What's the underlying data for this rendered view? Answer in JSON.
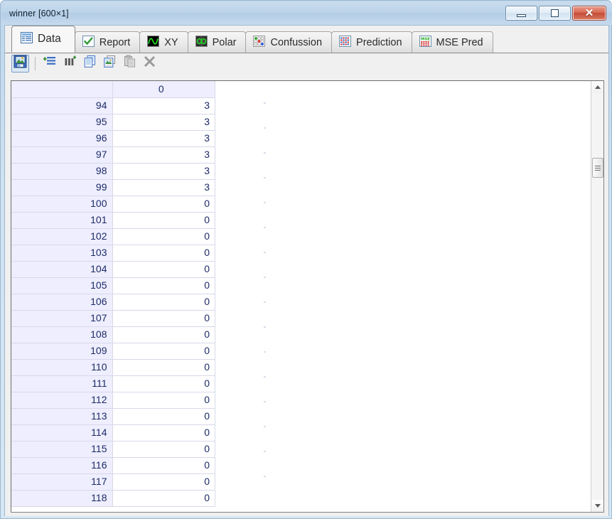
{
  "window": {
    "title": "winner [600×1]",
    "controls": {
      "minimize_label": "Minimize",
      "maximize_label": "Maximize",
      "close_label": "✕"
    }
  },
  "tabs": [
    {
      "id": "data",
      "label": "Data",
      "icon": "spreadsheet-grid-icon",
      "active": true
    },
    {
      "id": "report",
      "label": "Report",
      "icon": "green-check-icon",
      "active": false
    },
    {
      "id": "xy",
      "label": "XY",
      "icon": "sine-wave-icon",
      "active": false
    },
    {
      "id": "polar",
      "label": "Polar",
      "icon": "polar-figure-eight-icon",
      "active": false
    },
    {
      "id": "confussion",
      "label": "Confussion",
      "icon": "confusion-dots-icon",
      "active": false
    },
    {
      "id": "prediction",
      "label": "Prediction",
      "icon": "prediction-grid-icon",
      "active": false
    },
    {
      "id": "msepred",
      "label": "MSE Pred",
      "icon": "mse-grid-icon",
      "active": false
    }
  ],
  "toolbar": [
    {
      "id": "save-image",
      "icon": "save-picture-icon",
      "enabled": true,
      "title": "Save image"
    },
    {
      "id": "separator",
      "icon": "separator",
      "enabled": false,
      "title": ""
    },
    {
      "id": "insert-rows",
      "icon": "insert-rows-icon",
      "enabled": true,
      "title": "Insert rows"
    },
    {
      "id": "insert-columns",
      "icon": "insert-columns-icon",
      "enabled": true,
      "title": "Insert columns"
    },
    {
      "id": "copy",
      "icon": "copy-pages-icon",
      "enabled": true,
      "title": "Copy"
    },
    {
      "id": "copy-image",
      "icon": "copy-image-icon",
      "enabled": true,
      "title": "Copy image"
    },
    {
      "id": "paste",
      "icon": "paste-clipboard-icon",
      "enabled": false,
      "title": "Paste"
    },
    {
      "id": "delete",
      "icon": "delete-x-icon",
      "enabled": false,
      "title": "Delete"
    }
  ],
  "grid": {
    "corner_label": "",
    "columns": [
      "0"
    ],
    "rows": [
      {
        "index": "94",
        "values": [
          "3"
        ]
      },
      {
        "index": "95",
        "values": [
          "3"
        ]
      },
      {
        "index": "96",
        "values": [
          "3"
        ]
      },
      {
        "index": "97",
        "values": [
          "3"
        ]
      },
      {
        "index": "98",
        "values": [
          "3"
        ]
      },
      {
        "index": "99",
        "values": [
          "3"
        ]
      },
      {
        "index": "100",
        "values": [
          "0"
        ]
      },
      {
        "index": "101",
        "values": [
          "0"
        ]
      },
      {
        "index": "102",
        "values": [
          "0"
        ]
      },
      {
        "index": "103",
        "values": [
          "0"
        ]
      },
      {
        "index": "104",
        "values": [
          "0"
        ]
      },
      {
        "index": "105",
        "values": [
          "0"
        ]
      },
      {
        "index": "106",
        "values": [
          "0"
        ]
      },
      {
        "index": "107",
        "values": [
          "0"
        ]
      },
      {
        "index": "108",
        "values": [
          "0"
        ]
      },
      {
        "index": "109",
        "values": [
          "0"
        ]
      },
      {
        "index": "110",
        "values": [
          "0"
        ]
      },
      {
        "index": "111",
        "values": [
          "0"
        ]
      },
      {
        "index": "112",
        "values": [
          "0"
        ]
      },
      {
        "index": "113",
        "values": [
          "0"
        ]
      },
      {
        "index": "114",
        "values": [
          "0"
        ]
      },
      {
        "index": "115",
        "values": [
          "0"
        ]
      },
      {
        "index": "116",
        "values": [
          "0"
        ]
      },
      {
        "index": "117",
        "values": [
          "0"
        ]
      },
      {
        "index": "118",
        "values": [
          "0"
        ]
      }
    ]
  },
  "colors": {
    "titlebar_top": "#c9dcee",
    "titlebar_bottom": "#c6daed",
    "frame": "#cfe2f1",
    "row_header_bg": "#eeeeff",
    "header_text": "#1d2b66",
    "cell_text": "#1a1a1a",
    "close_button": "#c44b35",
    "tab_active_bg": "#f7f7f7",
    "toolbar_bg": "#f0f0f0"
  }
}
